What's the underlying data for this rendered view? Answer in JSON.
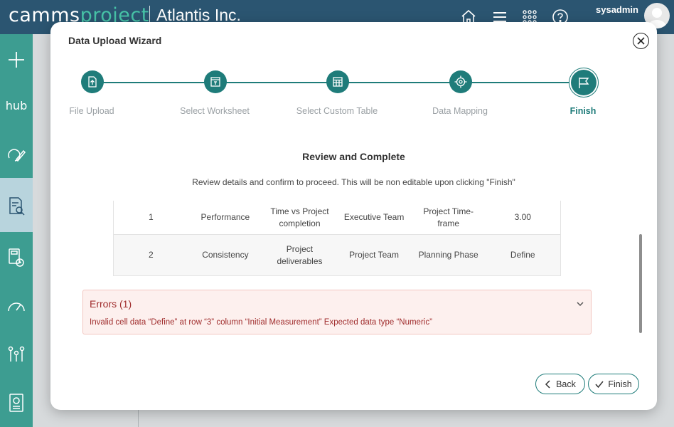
{
  "header": {
    "brand_main": "camms",
    "brand_accent": "project",
    "company": "Atlantis Inc.",
    "username": "sysadmin"
  },
  "nav": {
    "hub_label": "hub"
  },
  "modal": {
    "title": "Data Upload Wizard",
    "steps": [
      {
        "label": "File Upload",
        "icon": "file-upload-icon"
      },
      {
        "label": "Select Worksheet",
        "icon": "worksheet-icon"
      },
      {
        "label": "Select Custom Table",
        "icon": "table-icon"
      },
      {
        "label": "Data Mapping",
        "icon": "target-icon"
      },
      {
        "label": "Finish",
        "icon": "flag-icon",
        "active": true
      }
    ],
    "section_title": "Review and Complete",
    "section_desc": "Review details and confirm to proceed. This will be non editable upon clicking \"Finish\"",
    "table_rows": [
      [
        "1",
        "Performance",
        "Time vs Project completion",
        "Executive Team",
        "Project Time-frame",
        "3.00"
      ],
      [
        "2",
        "Consistency",
        "Project deliverables",
        "Project Team",
        "Planning Phase",
        "Define"
      ]
    ],
    "errors": {
      "title": "Errors (1)",
      "message": "Invalid cell data “Define” at row “3” column “Initial Measurement” Expected data type “Numeric”"
    },
    "buttons": {
      "back": "Back",
      "finish": "Finish"
    }
  },
  "colors": {
    "header_bg": "#2b5571",
    "nav_bg": "#3d9d91",
    "accent": "#1f7c7a",
    "error_text": "#a02d2d",
    "error_bg": "#fdf0ee"
  }
}
